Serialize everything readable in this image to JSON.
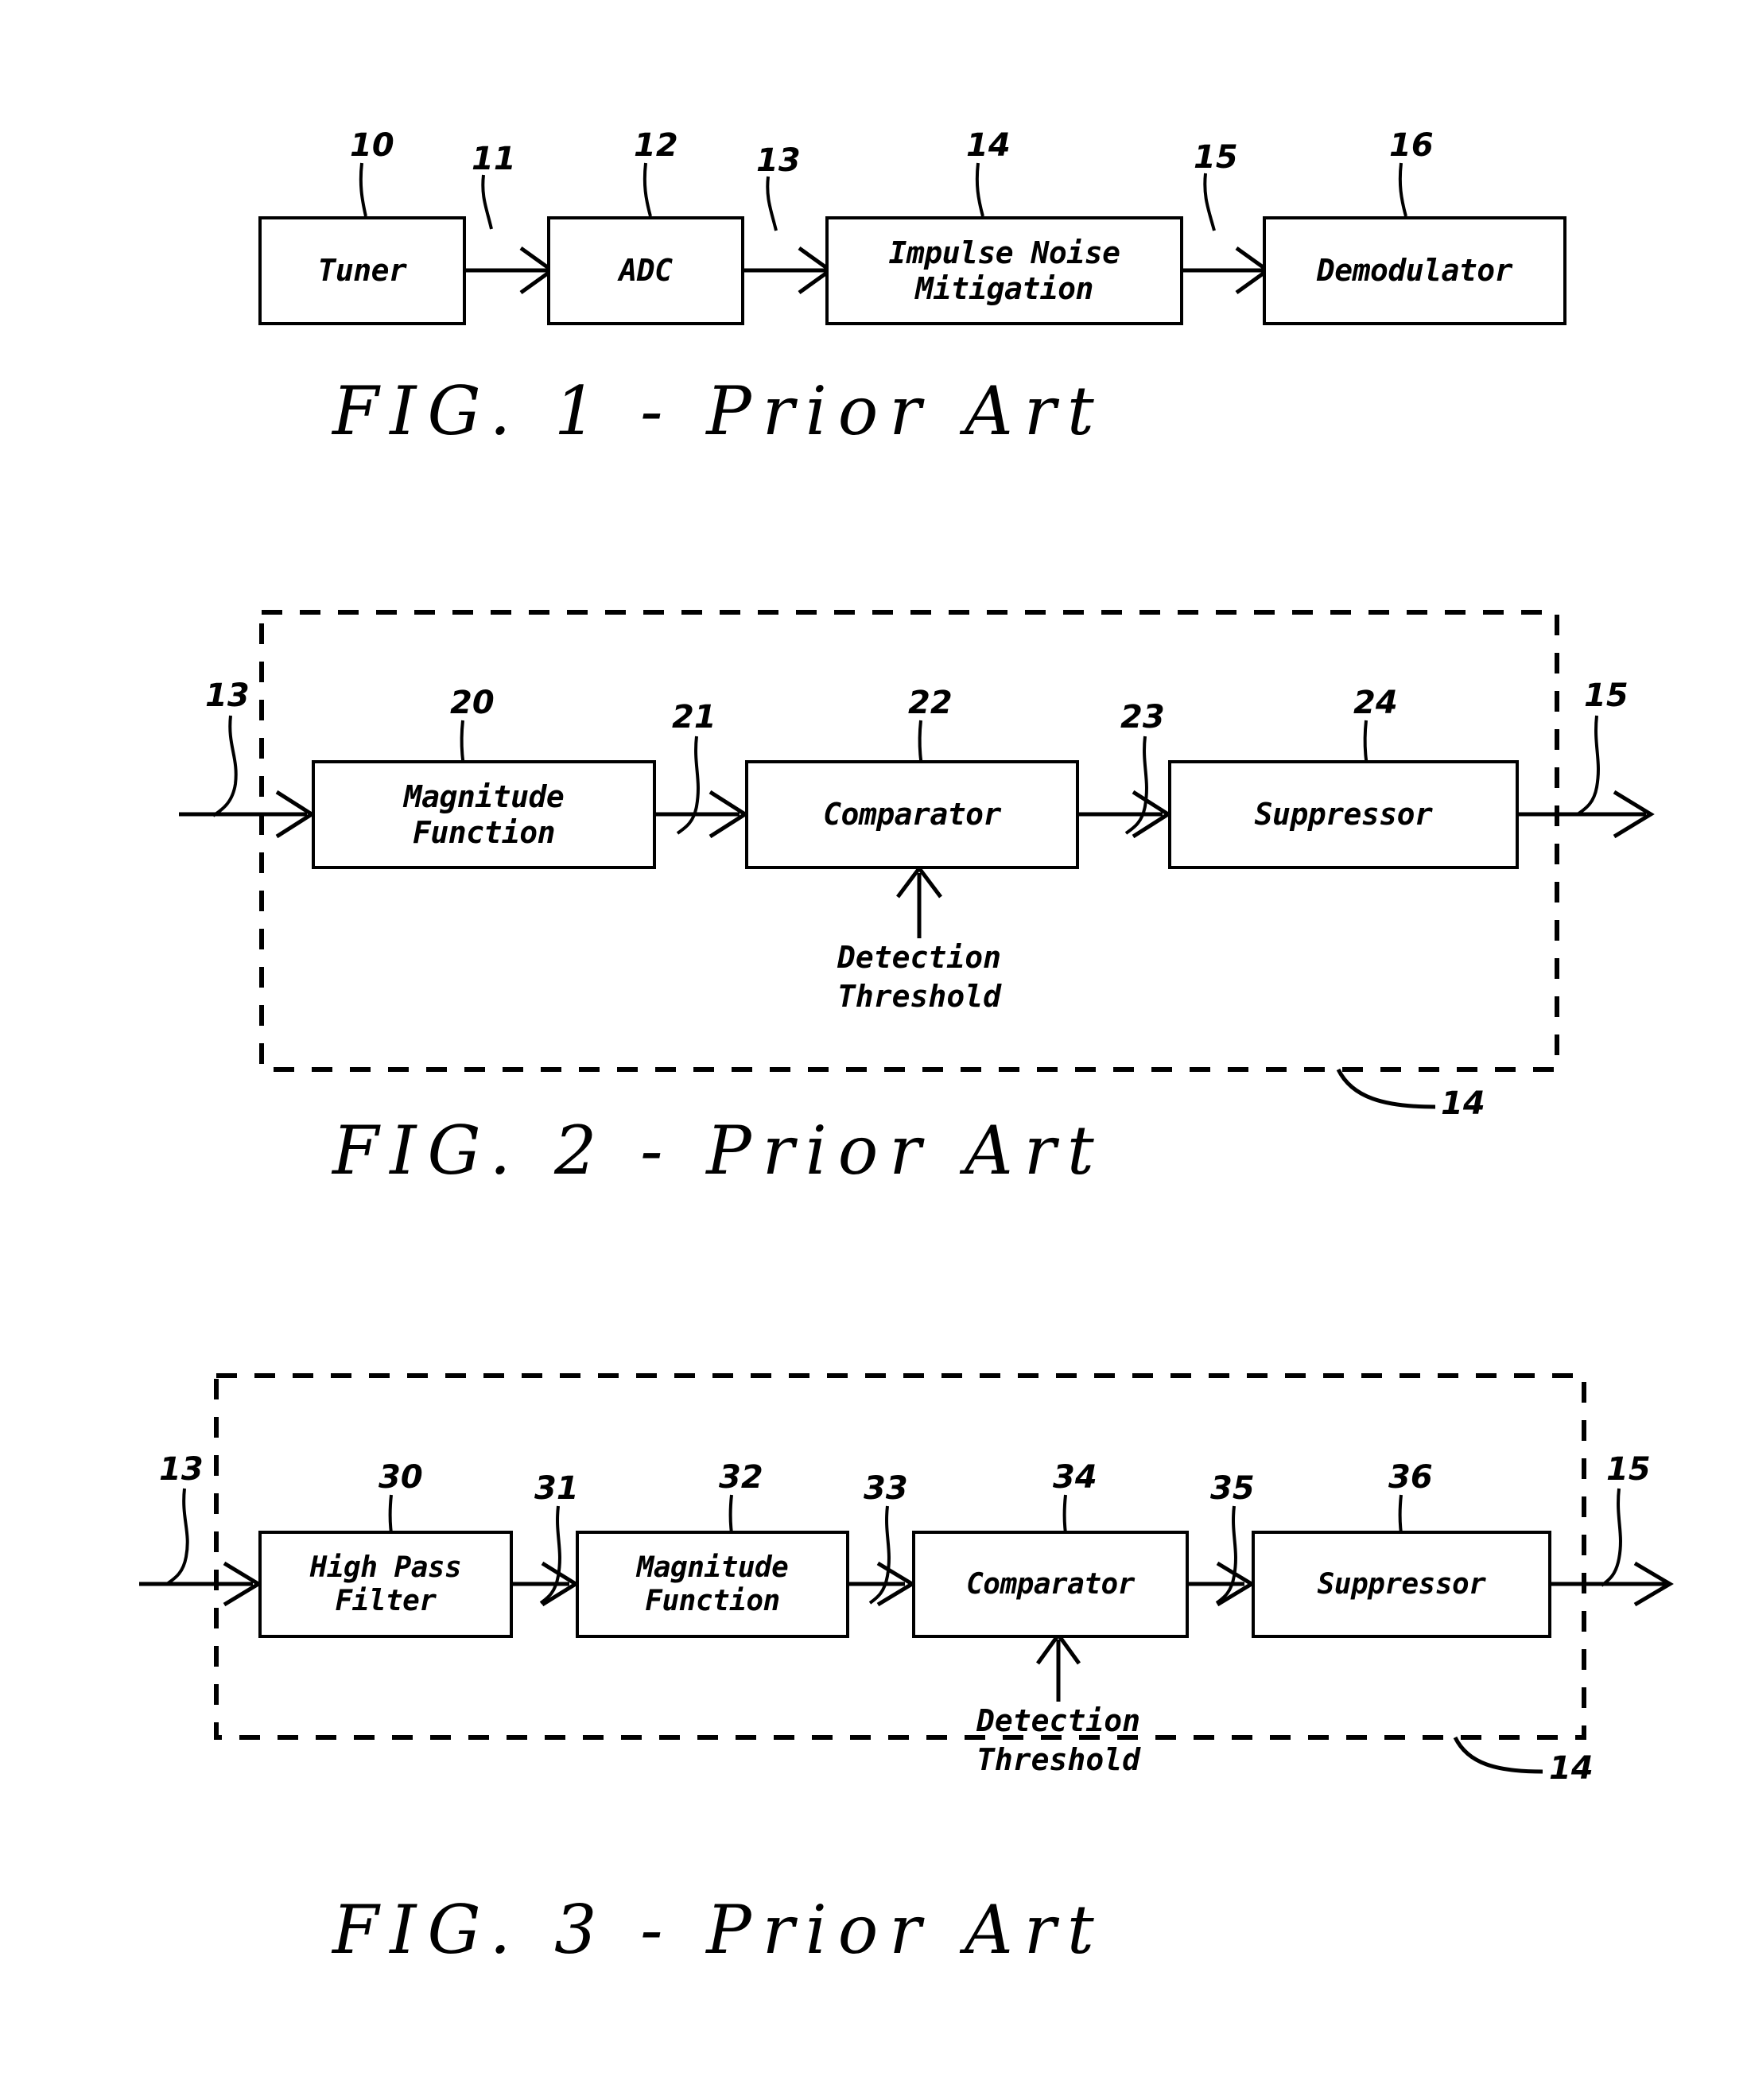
{
  "document": {
    "type": "patent-drawing-sheet",
    "background_color": "#ffffff",
    "ink_color": "#000000"
  },
  "figures": [
    {
      "id": "fig1",
      "caption": "FIG.  1  -  Prior  Art",
      "kind": "block-diagram",
      "dashed_enclosure": false,
      "blocks": [
        {
          "ref": "10",
          "label": "Tuner"
        },
        {
          "ref": "12",
          "label": "ADC"
        },
        {
          "ref": "14",
          "label": "Impulse Noise\nMitigation"
        },
        {
          "ref": "16",
          "label": "Demodulator"
        }
      ],
      "signals": [
        {
          "ref": "11",
          "from": "10",
          "to": "12"
        },
        {
          "ref": "13",
          "from": "12",
          "to": "14"
        },
        {
          "ref": "15",
          "from": "14",
          "to": "16"
        }
      ]
    },
    {
      "id": "fig2",
      "caption": "FIG.  2  -  Prior  Art",
      "kind": "block-diagram",
      "dashed_enclosure": true,
      "enclosure_ref": "14",
      "input_ref": "13",
      "output_ref": "15",
      "blocks": [
        {
          "ref": "20",
          "label": "Magnitude\nFunction"
        },
        {
          "ref": "22",
          "label": "Comparator"
        },
        {
          "ref": "24",
          "label": "Suppressor"
        }
      ],
      "signals": [
        {
          "ref": "21",
          "from": "20",
          "to": "22"
        },
        {
          "ref": "23",
          "from": "22",
          "to": "24"
        }
      ],
      "annotations": [
        {
          "text": "Detection\nThreshold",
          "target_ref": "22",
          "direction": "up"
        }
      ]
    },
    {
      "id": "fig3",
      "caption": "FIG.  3  -  Prior  Art",
      "kind": "block-diagram",
      "dashed_enclosure": true,
      "enclosure_ref": "14",
      "input_ref": "13",
      "output_ref": "15",
      "blocks": [
        {
          "ref": "30",
          "label": "High Pass\nFilter"
        },
        {
          "ref": "32",
          "label": "Magnitude\nFunction"
        },
        {
          "ref": "34",
          "label": "Comparator"
        },
        {
          "ref": "36",
          "label": "Suppressor"
        }
      ],
      "signals": [
        {
          "ref": "31",
          "from": "30",
          "to": "32"
        },
        {
          "ref": "33",
          "from": "32",
          "to": "34"
        },
        {
          "ref": "35",
          "from": "34",
          "to": "36"
        }
      ],
      "annotations": [
        {
          "text": "Detection\nThreshold",
          "target_ref": "34",
          "direction": "up"
        }
      ]
    }
  ]
}
